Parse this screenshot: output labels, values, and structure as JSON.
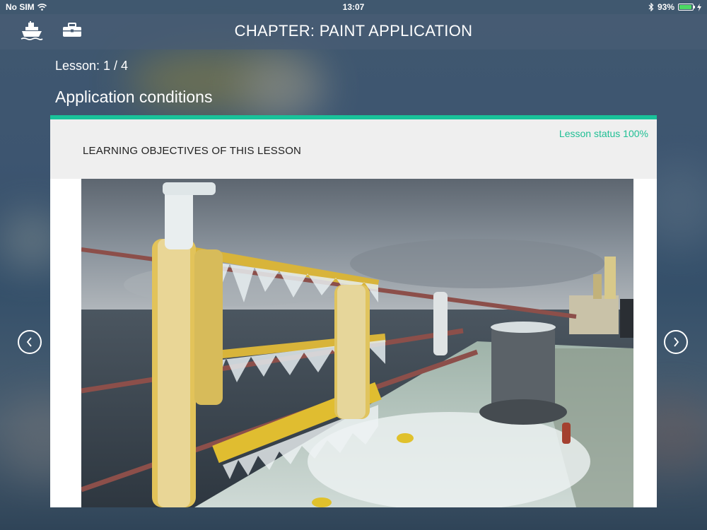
{
  "status_bar": {
    "carrier": "No SIM",
    "time": "13:07",
    "battery": "93%",
    "battery_level": 0.93
  },
  "nav": {
    "title": "CHAPTER: PAINT APPLICATION",
    "left_icons": [
      "ship-icon",
      "briefcase-icon"
    ]
  },
  "lesson": {
    "counter": "Lesson: 1 / 4",
    "title": "Application conditions"
  },
  "card": {
    "status": "Lesson status 100%",
    "objectives_heading": "LEARNING OBJECTIVES OF THIS LESSON",
    "image_subject": "iced ship deck railing at sea"
  },
  "navigation": {
    "prev_icon": "chevron-left-icon",
    "next_icon": "chevron-right-icon"
  },
  "colors": {
    "accent": "#19c29a",
    "status_text": "#1fbf94",
    "navbar": "#485c74"
  }
}
